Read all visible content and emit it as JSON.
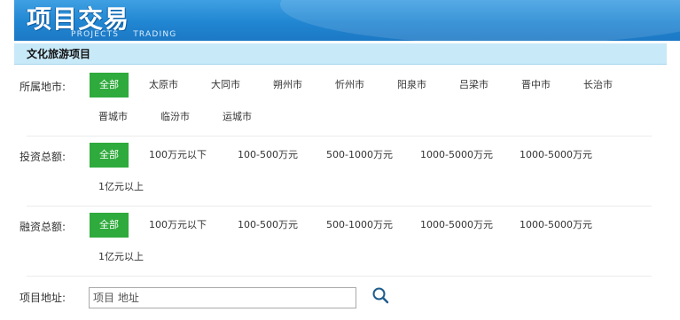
{
  "banner": {
    "title": "项目交易",
    "subtitle_words": [
      "PROJECTS",
      "TRADING"
    ]
  },
  "section": {
    "title": "文化旅游项目"
  },
  "filters": [
    {
      "label": "所属地市:",
      "options": [
        "全部",
        "太原市",
        "大同市",
        "朔州市",
        "忻州市",
        "阳泉市",
        "吕梁市",
        "晋中市",
        "长治市",
        "晋城市",
        "临汾市",
        "运城市"
      ],
      "selected": "全部"
    },
    {
      "label": "投资总额:",
      "options": [
        "全部",
        "100万元以下",
        "100-500万元",
        "500-1000万元",
        "1000-5000万元",
        "1000-5000万元",
        "1亿元以上"
      ],
      "selected": "全部"
    },
    {
      "label": "融资总额:",
      "options": [
        "全部",
        "100万元以下",
        "100-500万元",
        "500-1000万元",
        "1000-5000万元",
        "1000-5000万元",
        "1亿元以上"
      ],
      "selected": "全部"
    }
  ],
  "address": {
    "label": "项目地址:",
    "placeholder": "项目 地址",
    "search_icon": "search-icon"
  },
  "colors": {
    "banner": "#2186d2",
    "section_bar": "#c8e9f8",
    "active_option": "#2faa3c"
  }
}
